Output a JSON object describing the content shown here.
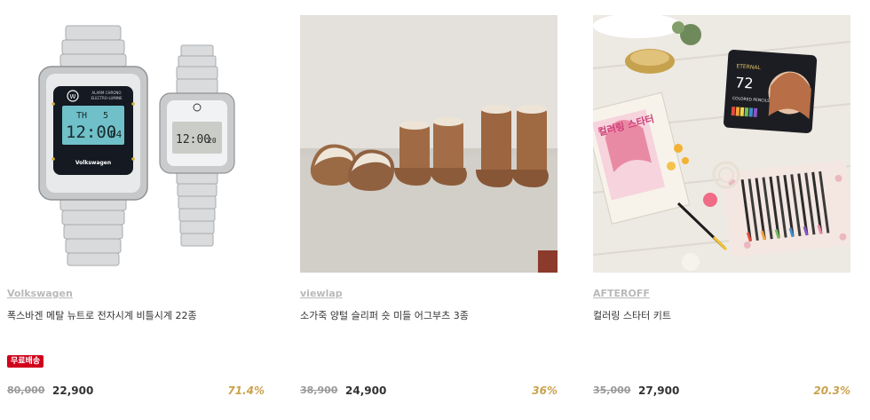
{
  "products": [
    {
      "brand": "Volkswagen",
      "title": "폭스바겐 메탈 뉴트로 전자시계 비틀시계 22종",
      "badge": "무료배송",
      "original_price": "80,000",
      "sale_price": "22,900",
      "discount": "71.4%",
      "image_text": {
        "big_watch_brand": "Volkswagen",
        "big_watch_top": "ALARM CHRONO",
        "big_watch_top2": "ELECTRO-LUMINE",
        "big_watch_time": "12:00",
        "big_watch_sec": "04",
        "big_watch_day": "TH",
        "big_watch_date": "5",
        "small_watch_time": "12:00",
        "small_watch_sec": "20"
      }
    },
    {
      "brand": "viewlap",
      "title": "소가죽 양털 슬리퍼 숏 미들 어그부츠 3종",
      "badge": "",
      "original_price": "38,900",
      "sale_price": "24,900",
      "discount": "36%",
      "image_text": {}
    },
    {
      "brand": "AFTEROFF",
      "title": "컬러링 스타터 키트",
      "badge": "",
      "original_price": "35,000",
      "sale_price": "27,900",
      "discount": "20.3%",
      "image_text": {
        "tin_brand": "ETERNAL",
        "tin_count": "72",
        "tin_sub": "COLORED PENCILS",
        "book_title": "컬러링 스타터"
      }
    }
  ],
  "colors": {
    "badge_bg": "#d0001b",
    "discount": "#c9a24d",
    "brand_link": "#b9b9b9"
  }
}
